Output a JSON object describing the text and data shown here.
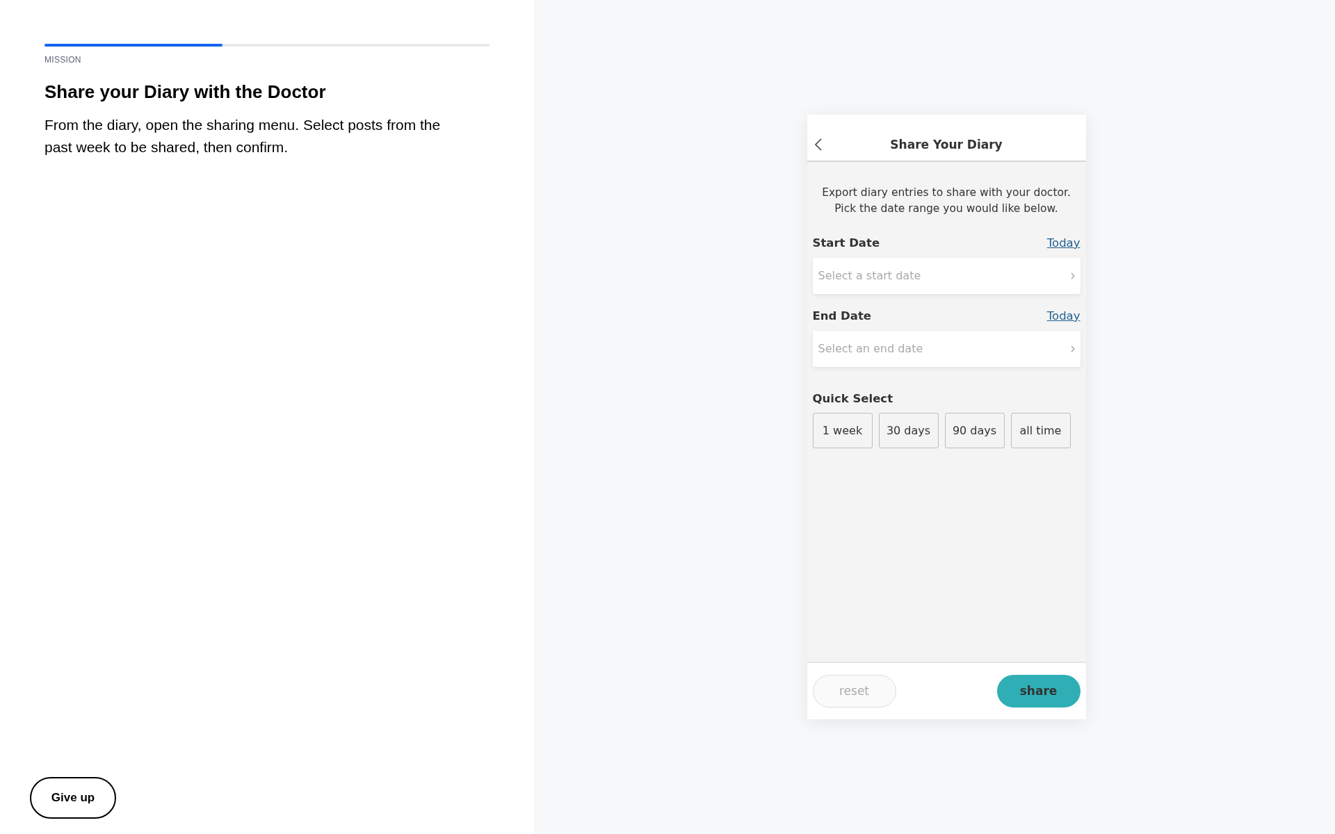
{
  "mission": {
    "progress": {
      "level": 0.4
    },
    "eyebrow": "MISSION",
    "title": "Share your Diary with the Doctor",
    "description": "From the diary, open the sharing menu. Select posts from the past week to be shared, then confirm.",
    "give_up_button": "Give up"
  },
  "phone": {
    "header": {
      "title": "Share Your Diary"
    },
    "intro": "Export diary entries to share with your doctor. Pick the date range you would like below.",
    "date_fields": [
      {
        "label": "Start Date",
        "link": "Today",
        "placeholder": "Select a start date"
      },
      {
        "label": "End Date",
        "link": "Today",
        "placeholder": "Select an end date"
      }
    ],
    "quick_select": {
      "label": "Quick Select",
      "options": [
        {
          "label": "1 week",
          "selected": false
        },
        {
          "label": "30 days",
          "selected": false
        },
        {
          "label": "90 days",
          "selected": false
        },
        {
          "label": "all time",
          "selected": false
        }
      ]
    },
    "footer": {
      "reset": {
        "label": "reset",
        "disabled": true
      },
      "share": {
        "label": "share",
        "disabled": false
      }
    }
  }
}
